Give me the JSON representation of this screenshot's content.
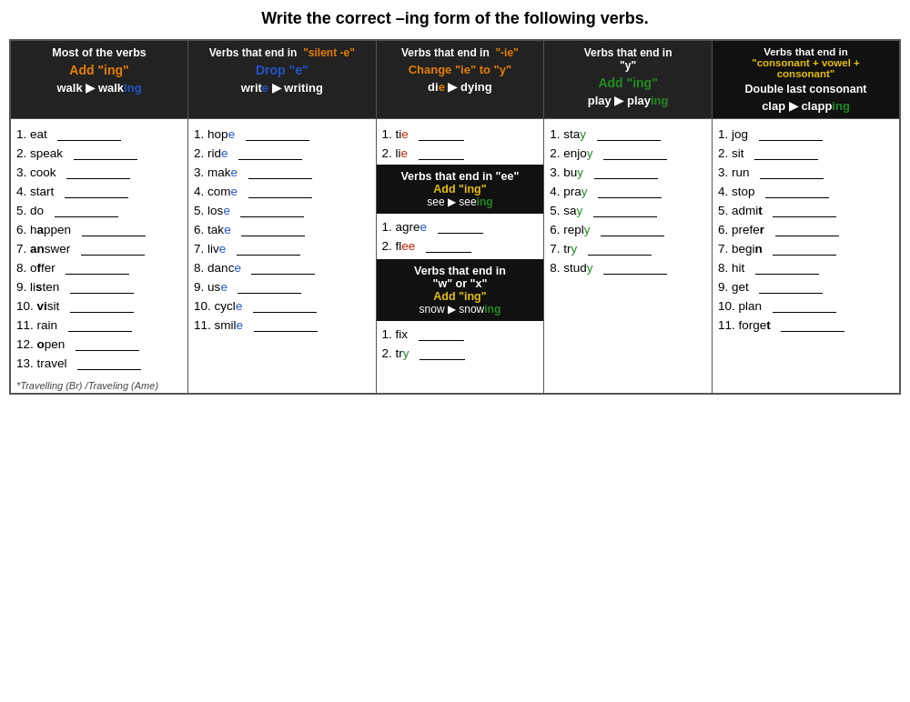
{
  "title": "Write the correct –ing form of the following verbs.",
  "columns": [
    {
      "id": "col1",
      "header_line1": "Most of the verbs",
      "rule": "Add \"ing\"",
      "rule_color": "orange",
      "example": "walk ▶ walk",
      "example_highlight": "ing",
      "bg": "white",
      "items": [
        {
          "num": "1.",
          "verb": "eat"
        },
        {
          "num": "2.",
          "verb": "speak"
        },
        {
          "num": "3.",
          "verb": "cook"
        },
        {
          "num": "4.",
          "verb": "start"
        },
        {
          "num": "5.",
          "verb": "do"
        },
        {
          "num": "6.",
          "verb": "h",
          "bold": "a",
          "rest": "ppen"
        },
        {
          "num": "7.",
          "verb": "an",
          "bold2": true,
          "rest2": "swer"
        },
        {
          "num": "8.",
          "verb": "o",
          "bold": "f",
          "rest": "fer"
        },
        {
          "num": "9.",
          "verb": "li",
          "bold": "s",
          "rest": "ten"
        },
        {
          "num": "10.",
          "verb": "vi",
          "bold": "s",
          "rest": "it"
        },
        {
          "num": "11.",
          "verb": "rain"
        },
        {
          "num": "12.",
          "verb": "o",
          "bold": "p",
          "rest": "en"
        },
        {
          "num": "13.",
          "verb": "travel"
        }
      ],
      "note": "*Travelling (Br) /Traveling (Ame)"
    },
    {
      "id": "col2",
      "header_line1": "Verbs that end in  \"silent -e\"",
      "rule": "Drop \"e\"",
      "rule_color": "blue",
      "example": "write ▶ writing",
      "example_e_blue": true,
      "bg": "white",
      "items": [
        {
          "num": "1.",
          "verb": "hop",
          "e_color": "blue"
        },
        {
          "num": "2.",
          "verb": "rid",
          "e_color": "blue"
        },
        {
          "num": "3.",
          "verb": "mak",
          "e_color": "blue"
        },
        {
          "num": "4.",
          "verb": "com",
          "e_color": "blue"
        },
        {
          "num": "5.",
          "verb": "los",
          "e_color": "blue"
        },
        {
          "num": "6.",
          "verb": "tak",
          "e_color": "blue"
        },
        {
          "num": "7.",
          "verb": "liv",
          "e_color": "blue"
        },
        {
          "num": "8.",
          "verb": "danc",
          "e_color": "blue"
        },
        {
          "num": "9.",
          "verb": "us",
          "e_color": "blue"
        },
        {
          "num": "10.",
          "verb": "cycl",
          "e_color": "blue"
        },
        {
          "num": "11.",
          "verb": "smil",
          "e_color": "blue"
        }
      ]
    },
    {
      "id": "col3",
      "header_line1": "Verbs that end in  \"-ie\"",
      "rule": "Change \"ie\" to \"y\"",
      "rule_color": "orange",
      "example": "die ▶ dying",
      "bg": "white",
      "sub_sections": [
        {
          "header": "Verbs that end in \"ee\"",
          "rule": "Add \"ing\"",
          "example": "see ▶ see",
          "example_ing": "ing",
          "bg": "black",
          "items": [
            {
              "num": "1.",
              "verb": "agre",
              "e_color": "blue"
            },
            {
              "num": "2.",
              "verb": "fle",
              "e_color": "blue"
            }
          ]
        },
        {
          "header": "Verbs that end in\n\"w\" or \"x\"",
          "rule": "Add \"ing\"",
          "example": "snow ▶ snow",
          "example_ing": "ing",
          "bg": "black",
          "items": [
            {
              "num": "1.",
              "verb": "fix"
            },
            {
              "num": "2.",
              "verb": "tr",
              "y_green": true
            }
          ]
        }
      ],
      "items_top": [
        {
          "num": "1.",
          "verb": "ti",
          "ie_red": true
        },
        {
          "num": "2.",
          "verb": "li",
          "ie_red": true
        }
      ]
    },
    {
      "id": "col4",
      "header_line1": "Verbs that end in\n\"y\"",
      "rule": "Add \"ing\"",
      "rule_color": "green",
      "example": "play ▶ play",
      "example_ing": "ing",
      "bg": "white",
      "items": [
        {
          "num": "1.",
          "verb": "sta",
          "y_green": true
        },
        {
          "num": "2.",
          "verb": "enjo",
          "y_green": true
        },
        {
          "num": "3.",
          "verb": "bu",
          "y_green": true
        },
        {
          "num": "4.",
          "verb": "pra",
          "y_green": true
        },
        {
          "num": "5.",
          "verb": "sa",
          "y_green": true
        },
        {
          "num": "6.",
          "verb": "repl",
          "y_green": true
        },
        {
          "num": "7.",
          "verb": "tr",
          "y_green": true
        },
        {
          "num": "8.",
          "verb": "stud",
          "y_green": true
        }
      ]
    },
    {
      "id": "col5",
      "header_line1": "Verbs that end in\n\"consonant + vowel +\nconsonant\"",
      "rule": "Double last consonant",
      "rule_color": "white",
      "bg": "black",
      "example": "clap ▶ clapp",
      "example_ing": "ing",
      "items": [
        {
          "num": "1.",
          "verb": "jog"
        },
        {
          "num": "2.",
          "verb": "sit"
        },
        {
          "num": "3.",
          "verb": "run"
        },
        {
          "num": "4.",
          "verb": "stop"
        },
        {
          "num": "5.",
          "verb": "admi",
          "bold": "t"
        },
        {
          "num": "6.",
          "verb": "prefe",
          "bold": "r"
        },
        {
          "num": "7.",
          "verb": "begi",
          "bold": "n"
        },
        {
          "num": "8.",
          "verb": "hit"
        },
        {
          "num": "9.",
          "verb": "get"
        },
        {
          "num": "10.",
          "verb": "plan"
        },
        {
          "num": "11.",
          "verb": "forge",
          "bold": "t"
        }
      ]
    }
  ]
}
